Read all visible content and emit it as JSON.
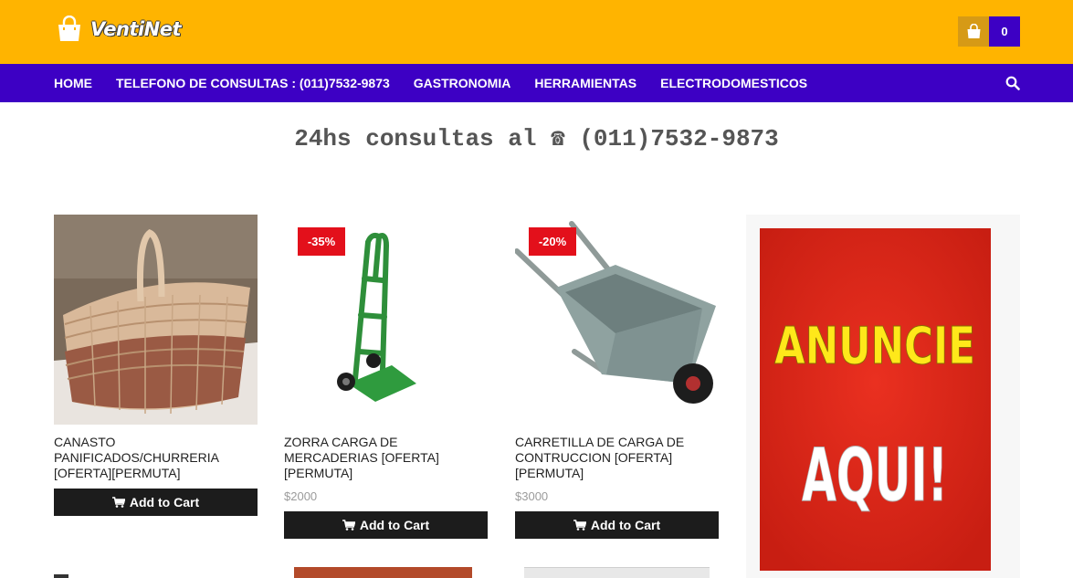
{
  "header": {
    "logo_text": "VentiNet",
    "cart_count": "0",
    "brand_color": "#ffb400",
    "accent_color": "#3d00c4"
  },
  "nav": {
    "items": [
      {
        "label": "HOME"
      },
      {
        "label": "TELEFONO DE CONSULTAS : (011)7532-9873"
      },
      {
        "label": "GASTRONOMIA"
      },
      {
        "label": "HERRAMIENTAS"
      },
      {
        "label": "ELECTRODOMESTICOS"
      }
    ],
    "search_icon": "search-icon"
  },
  "banner": {
    "text": "24hs consultas al ☎ (011)7532-9873"
  },
  "products": [
    {
      "title": "CANASTO PANIFICADOS/CHURRERIA [OFERTA][PERMUTA]",
      "price": "",
      "badge": "",
      "button": "Add to Cart"
    },
    {
      "title": "ZORRA CARGA DE MERCADERIAS [OFERTA][PERMUTA]",
      "price": "$2000",
      "badge": "-35%",
      "button": "Add to Cart"
    },
    {
      "title": "CARRETILLA DE CARGA DE CONTRUCCION [OFERTA][PERMUTA]",
      "price": "$3000",
      "badge": "-20%",
      "button": "Add to Cart"
    }
  ],
  "ad": {
    "line1": "ANUNCIE",
    "line2": "AQUI!"
  }
}
